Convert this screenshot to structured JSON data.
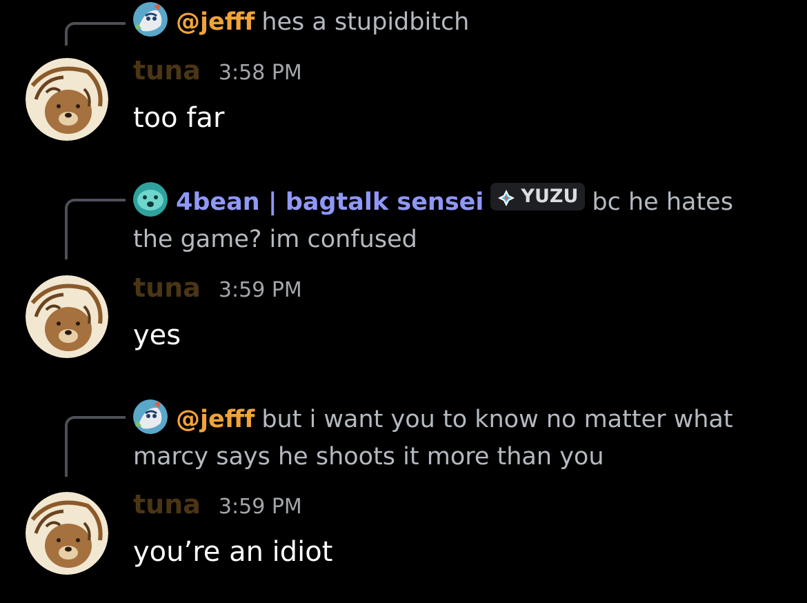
{
  "colors": {
    "background": "#000000",
    "reply_jefff": "#f0a33a",
    "reply_bean": "#8f98f7",
    "username_tuna": "#4a3515",
    "timestamp": "#a3a6aa",
    "message_text": "#ffffff",
    "reply_text": "#b5bac1"
  },
  "messages": [
    {
      "reply": {
        "author": "@jefff",
        "author_avatar_icon": "cartoon-character-avatar",
        "text": "hes a stupidbitch"
      },
      "author": "tuna",
      "avatar_icon": "bear-avatar",
      "time": "3:58 PM",
      "content": "too far"
    },
    {
      "reply": {
        "author": "4bean | bagtalk sensei",
        "author_avatar_icon": "blue-ball-avatar",
        "tag": "YUZU",
        "tag_icon": "diamond-sparkle-icon",
        "text": "bc he hates the game? im confused"
      },
      "author": "tuna",
      "avatar_icon": "bear-avatar",
      "time": "3:59 PM",
      "content": "yes"
    },
    {
      "reply": {
        "author": "@jefff",
        "author_avatar_icon": "cartoon-character-avatar",
        "text": "but i want you to know no matter what marcy says he shoots it more than you"
      },
      "author": "tuna",
      "avatar_icon": "bear-avatar",
      "time": "3:59 PM",
      "content": "you’re an idiot"
    }
  ]
}
